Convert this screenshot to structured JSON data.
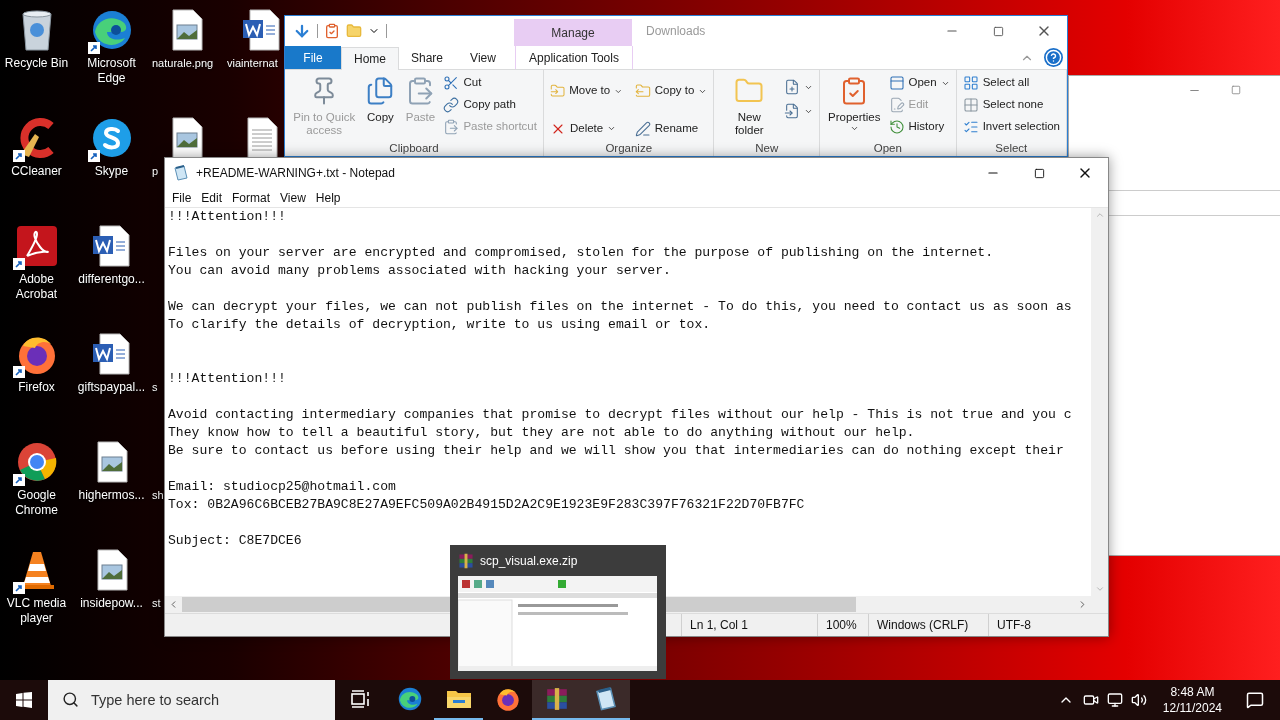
{
  "desktop": {
    "columns": [
      {
        "kind": "open",
        "icons": [
          {
            "label": "Recycle Bin",
            "kind": "recycle",
            "shortcut": false
          },
          {
            "label": "CCleaner",
            "kind": "ccleaner",
            "shortcut": true
          },
          {
            "label": "Adobe Acrobat",
            "kind": "acrobat",
            "shortcut": true
          },
          {
            "label": "Firefox",
            "kind": "firefox",
            "shortcut": true
          },
          {
            "label": "Google Chrome",
            "kind": "chrome",
            "shortcut": true
          },
          {
            "label": "VLC media player",
            "kind": "vlc",
            "shortcut": true
          }
        ]
      },
      {
        "kind": "open",
        "icons": [
          {
            "label": "Microsoft Edge",
            "kind": "edge",
            "shortcut": true
          },
          {
            "label": "Skype",
            "kind": "skype",
            "shortcut": true
          },
          {
            "label": "differentgo...",
            "kind": "word",
            "shortcut": false
          },
          {
            "label": "giftspaypal...",
            "kind": "word",
            "shortcut": false
          },
          {
            "label": "highermos...",
            "kind": "image",
            "shortcut": false
          },
          {
            "label": "insidepow...",
            "kind": "image",
            "shortcut": false
          }
        ]
      },
      {
        "kind": "covered",
        "icons": [
          {
            "label": "naturale.png",
            "kind": "image",
            "shortcut": false
          },
          {
            "label": "p",
            "kind": "image",
            "shortcut": false
          }
        ],
        "lower_icons": [
          {
            "label": "s"
          },
          {
            "label": "sh"
          },
          {
            "label": "st"
          }
        ]
      },
      {
        "kind": "covered",
        "icons": [
          {
            "label": "viainternat",
            "kind": "word",
            "shortcut": false
          },
          {
            "kind": "textdoc",
            "shortcut": false
          }
        ]
      }
    ]
  },
  "explorer": {
    "title": "Downloads",
    "context_tab": "Manage",
    "tabs": [
      {
        "label": "File",
        "kind": "file",
        "selected": false
      },
      {
        "label": "Home",
        "kind": "tab",
        "selected": true
      },
      {
        "label": "Share",
        "kind": "tab",
        "selected": false
      },
      {
        "label": "View",
        "kind": "tab",
        "selected": false
      },
      {
        "label": "Application Tools",
        "kind": "context",
        "selected": false
      }
    ],
    "groups": [
      {
        "label": "Clipboard",
        "large": [
          {
            "label": "Pin to Quick access",
            "kind": "pin",
            "disabled": true,
            "dropdown": false
          },
          {
            "label": "Copy",
            "kind": "copy",
            "disabled": false,
            "dropdown": false
          },
          {
            "label": "Paste",
            "kind": "paste",
            "disabled": true,
            "dropdown": false
          }
        ],
        "small": [
          {
            "label": "Cut",
            "kind": "cut",
            "disabled": false,
            "dropdown": false
          },
          {
            "label": "Copy path",
            "kind": "copypath",
            "disabled": false,
            "dropdown": false
          },
          {
            "label": "Paste shortcut",
            "kind": "pasteshortcut",
            "disabled": true,
            "dropdown": false
          }
        ]
      },
      {
        "label": "Organize",
        "small": [
          {
            "label": "Move to",
            "kind": "moveto",
            "disabled": false,
            "dropdown": true
          },
          {
            "label": "Copy to",
            "kind": "copyto",
            "disabled": false,
            "dropdown": true
          },
          {
            "label": "Delete",
            "kind": "delete",
            "disabled": false,
            "dropdown": true
          },
          {
            "label": "Rename",
            "kind": "rename",
            "disabled": false,
            "dropdown": false
          }
        ]
      },
      {
        "label": "New",
        "large": [
          {
            "label": "New folder",
            "kind": "newfolder",
            "disabled": false,
            "dropdown": false
          }
        ],
        "small": [
          {
            "kind": "newitem",
            "disabled": false,
            "dropdown": true
          },
          {
            "kind": "easyaccess",
            "disabled": false,
            "dropdown": true
          }
        ]
      },
      {
        "label": "Open",
        "large": [
          {
            "label": "Properties",
            "kind": "properties",
            "disabled": false,
            "dropdown": true
          }
        ],
        "small": [
          {
            "label": "Open",
            "kind": "open",
            "disabled": false,
            "dropdown": true
          },
          {
            "label": "Edit",
            "kind": "edit",
            "disabled": true,
            "dropdown": false
          },
          {
            "label": "History",
            "kind": "history",
            "disabled": false,
            "dropdown": false
          }
        ]
      },
      {
        "label": "Select",
        "small": [
          {
            "label": "Select all",
            "kind": "selectall",
            "disabled": false,
            "dropdown": false
          },
          {
            "label": "Select none",
            "kind": "selectnone",
            "disabled": false,
            "dropdown": false
          },
          {
            "label": "Invert selection",
            "kind": "invert",
            "disabled": false,
            "dropdown": false
          }
        ]
      }
    ]
  },
  "notepad": {
    "title": "+README-WARNING+.txt - Notepad",
    "menu": [
      "File",
      "Edit",
      "Format",
      "View",
      "Help"
    ],
    "text": "!!!Attention!!!\n\nFiles on your server are encrypted and compromised, stolen for the purpose of publishing on the internet.\nYou can avoid many problems associated with hacking your server.\n\nWe can decrypt your files, we can not publish files on the internet - To do this, you need to contact us as soon as\nTo clarify the details of decryption, write to us using email or tox.\n\n\n!!!Attention!!!\n\nAvoid contacting intermediary companies that promise to decrypt files without our help - This is not true and you c\nThey know how to tell a beautiful story, but they are not able to do anything without our help.\nBe sure to contact us before using their help and we will show you that intermediaries can do nothing except their\n\nEmail: studiocp25@hotmail.com\nTox: 0B2A96C6BCEB27BA9C8E27A9EFC509A02B4915D2A2C9E1923E9F283C397F76321F22D70FB7FC\n\nSubject: C8E7DCE6",
    "status": [
      "Ln 1, Col 1",
      "100%",
      "Windows (CRLF)",
      "UTF-8"
    ]
  },
  "thumbnail": {
    "title": "scp_visual.exe.zip"
  },
  "taskbar": {
    "search": {
      "placeholder": "Type here to search"
    },
    "apps": [
      {
        "kind": "taskview",
        "running": false,
        "highlighted": false
      },
      {
        "kind": "edge",
        "running": false,
        "highlighted": false
      },
      {
        "kind": "explorer",
        "running": true,
        "highlighted": false
      },
      {
        "kind": "firefox",
        "running": false,
        "highlighted": false
      },
      {
        "kind": "winrar",
        "running": true,
        "highlighted": true
      },
      {
        "kind": "notepad",
        "running": true,
        "highlighted": true
      }
    ],
    "time": "8:48 AM",
    "date": "12/11/2024"
  }
}
